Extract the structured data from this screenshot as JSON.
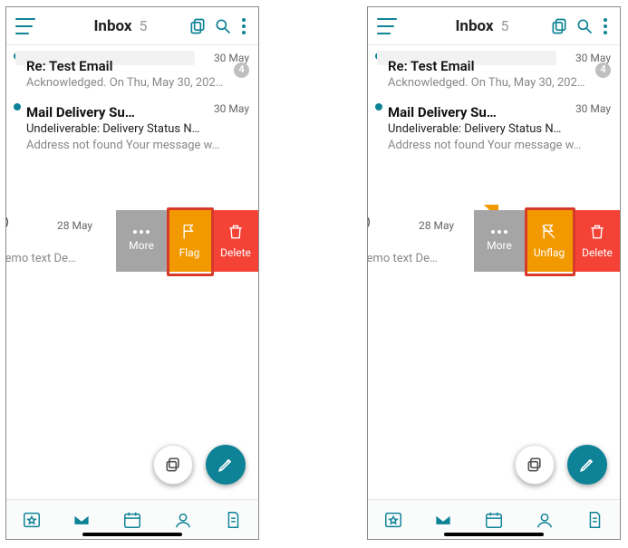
{
  "header": {
    "title": "Inbox",
    "count": "5"
  },
  "dates": {
    "row1": "30 May",
    "row2": "30 May",
    "swipe": "28 May"
  },
  "row1": {
    "subject": "Re: Test Email",
    "snippet": "Acknowledged. On Thu, May 30, 202…",
    "badge": "4"
  },
  "row2": {
    "subject": "Mail Delivery Subsy…",
    "line2": "Undeliverable: Delivery Status N…",
    "line3": "Address not found Your message w…"
  },
  "swipe": {
    "id_fragment": "C)",
    "preview": "Demo text De…"
  },
  "actions": {
    "more": "More",
    "flag": "Flag",
    "unflag": "Unflag",
    "delete": "Delete"
  },
  "colors": {
    "teal": "#0e8296",
    "flag": "#f29900",
    "delete": "#f44336",
    "more": "#a5a5a5",
    "highlight": "#d83a2a"
  }
}
